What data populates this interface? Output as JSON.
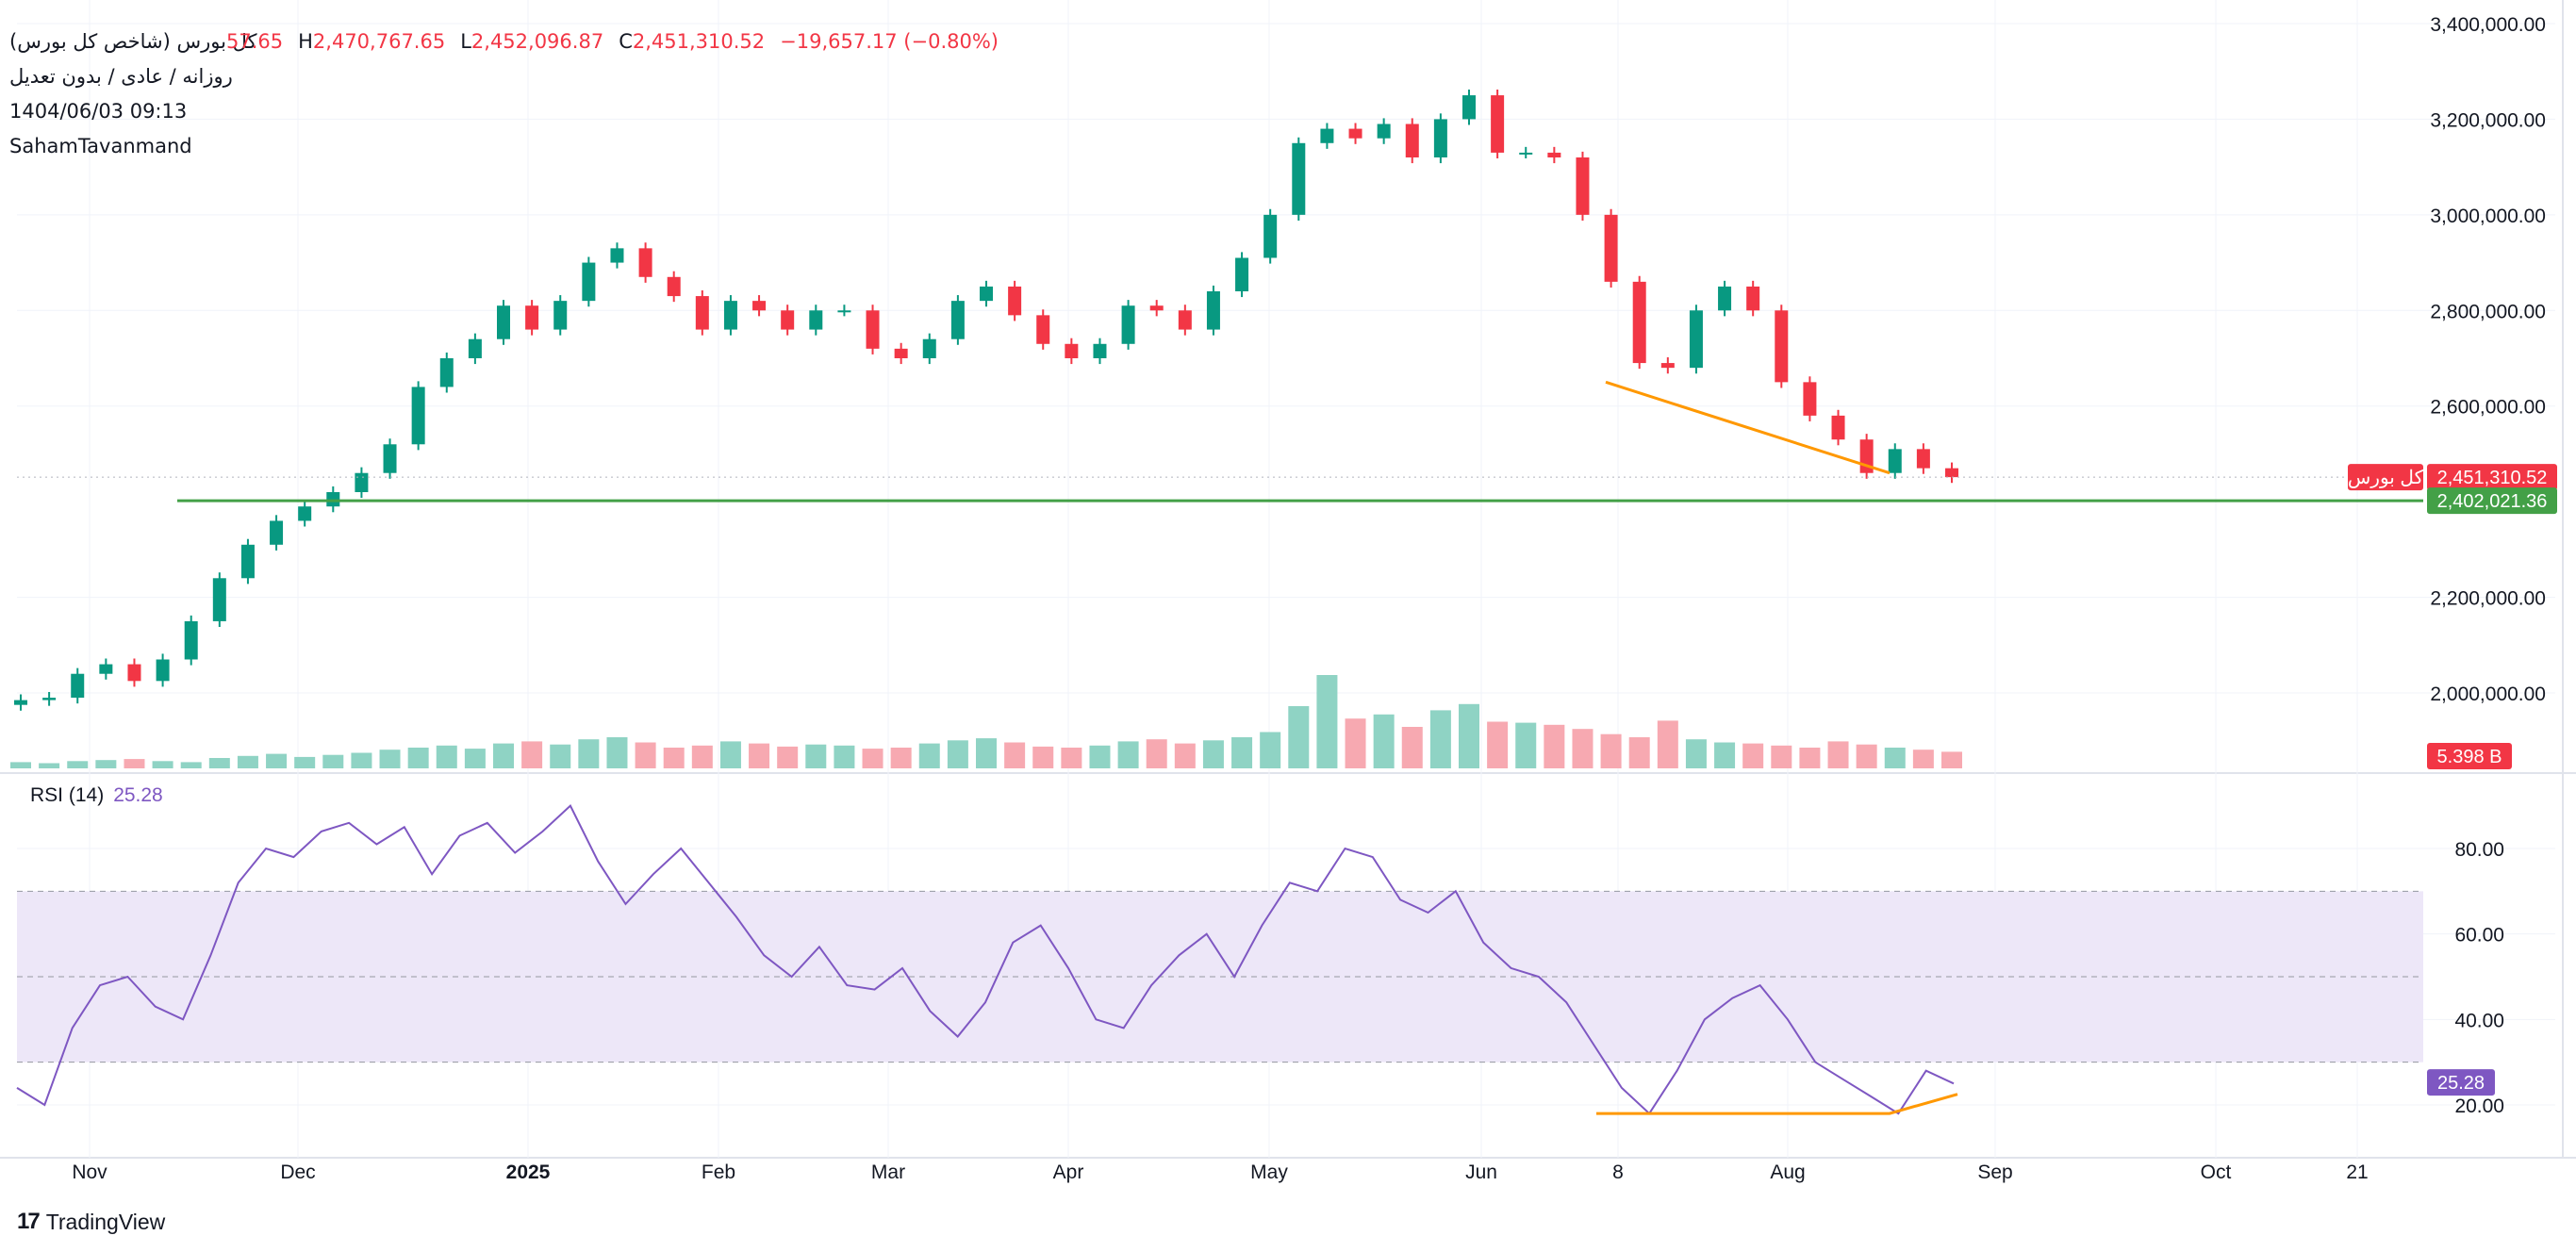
{
  "legend": {
    "title": "کل بورس (شاخص کل بورس)",
    "subtitle": "روزانه / عادی / بدون تعدیل",
    "datetime": "1404/06/03 09:13",
    "author": "SahamTavanmand",
    "open_partial": "57.65",
    "h_label": "H",
    "high": "2,470,767.65",
    "l_label": "L",
    "low": "2,452,096.87",
    "c_label": "C",
    "close": "2,451,310.52",
    "change": "−19,657.17 (−0.80%)"
  },
  "rsi": {
    "label": "RSI (14)",
    "value": "25.28"
  },
  "badges": {
    "symbol": "کل بورس",
    "last_price": "2,451,310.52",
    "line_price": "2,402,021.36",
    "volume": "5.398 B",
    "rsi": "25.28"
  },
  "logo": {
    "mark": "17",
    "name": "TradingView"
  },
  "colors": {
    "up": "#089981",
    "down": "#f23645",
    "vol_up": "#8fd3c4",
    "vol_down": "#f7a9b1",
    "rsi_line": "#7e57c2",
    "rsi_band": "#ede7f8",
    "support": "#43a047",
    "divergence": "#ff9800"
  },
  "chart_data": [
    {
      "type": "candlestick",
      "panel": "price",
      "y_axis_ticks": [
        "3,400,000.00",
        "3,200,000.00",
        "3,000,000.00",
        "2,800,000.00",
        "2,600,000.00",
        "2,200,000.00",
        "2,000,000.00"
      ],
      "x_axis_ticks": [
        "Nov",
        "Dec",
        "2025",
        "Feb",
        "Mar",
        "Apr",
        "May",
        "Jun",
        "8",
        "Aug",
        "Sep",
        "Oct",
        "21"
      ],
      "ylim": [
        1950000,
        3400000
      ],
      "horizontal_line": 2402021.36,
      "last_close": 2451310.52,
      "close_series": [
        1985000,
        1990000,
        2040000,
        2060000,
        2025000,
        2070000,
        2150000,
        2240000,
        2310000,
        2360000,
        2390000,
        2420000,
        2460000,
        2520000,
        2640000,
        2700000,
        2740000,
        2810000,
        2760000,
        2820000,
        2900000,
        2930000,
        2870000,
        2830000,
        2760000,
        2820000,
        2800000,
        2760000,
        2800000,
        2800000,
        2720000,
        2700000,
        2740000,
        2820000,
        2850000,
        2790000,
        2730000,
        2700000,
        2730000,
        2810000,
        2800000,
        2760000,
        2840000,
        2910000,
        3000000,
        3150000,
        3180000,
        3160000,
        3190000,
        3120000,
        3200000,
        3250000,
        3130000,
        3130000,
        3120000,
        3000000,
        2860000,
        2690000,
        2680000,
        2800000,
        2850000,
        2800000,
        2650000,
        2580000,
        2530000,
        2460000,
        2510000,
        2470000,
        2451310
      ]
    },
    {
      "type": "bar",
      "panel": "volume",
      "last_value": "5.398 B"
    },
    {
      "type": "line",
      "panel": "rsi",
      "name": "RSI (14)",
      "y_axis_ticks": [
        "80.00",
        "60.00",
        "40.00",
        "20.00"
      ],
      "ylim": [
        14,
        92
      ],
      "bands": [
        30,
        50,
        70
      ],
      "last_value": 25.28,
      "values": [
        24,
        20,
        38,
        48,
        50,
        43,
        40,
        55,
        72,
        80,
        78,
        84,
        86,
        81,
        85,
        74,
        83,
        86,
        79,
        84,
        90,
        77,
        67,
        74,
        80,
        72,
        64,
        55,
        50,
        57,
        48,
        47,
        52,
        42,
        36,
        44,
        58,
        62,
        52,
        40,
        38,
        48,
        55,
        60,
        50,
        62,
        72,
        70,
        80,
        78,
        68,
        65,
        70,
        58,
        52,
        50,
        44,
        34,
        24,
        18,
        28,
        40,
        45,
        48,
        40,
        30,
        26,
        22,
        18,
        28,
        25
      ]
    }
  ]
}
